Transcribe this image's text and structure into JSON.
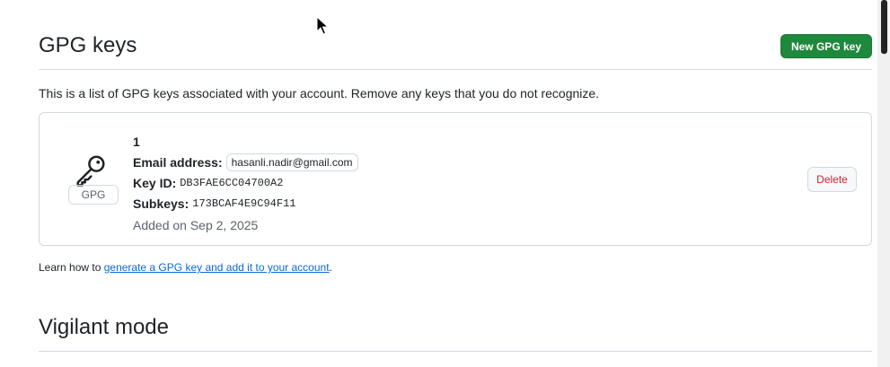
{
  "gpg_section": {
    "title": "GPG keys",
    "new_button": "New GPG key",
    "intro": "This is a list of GPG keys associated with your account. Remove any keys that you do not recognize.",
    "key": {
      "badge": "GPG",
      "name": "1",
      "email_label": "Email address:",
      "email": "hasanli.nadir@gmail.com",
      "key_id_label": "Key ID:",
      "key_id": "DB3FAE6CC04700A2",
      "subkeys_label": "Subkeys:",
      "subkeys": "173BCAF4E9C94F11",
      "added": "Added on Sep 2, 2025",
      "delete_button": "Delete"
    },
    "learn_prefix": "Learn how to ",
    "learn_link": "generate a GPG key and add it to your account",
    "learn_suffix": "."
  },
  "vigilant_section": {
    "title": "Vigilant mode"
  },
  "colors": {
    "primary_button": "#1f883d",
    "danger_text": "#d1242f",
    "link": "#0969da",
    "border": "#d1d9e0"
  },
  "icons": {
    "key": "key-icon",
    "cursor": "mouse-pointer-icon"
  }
}
